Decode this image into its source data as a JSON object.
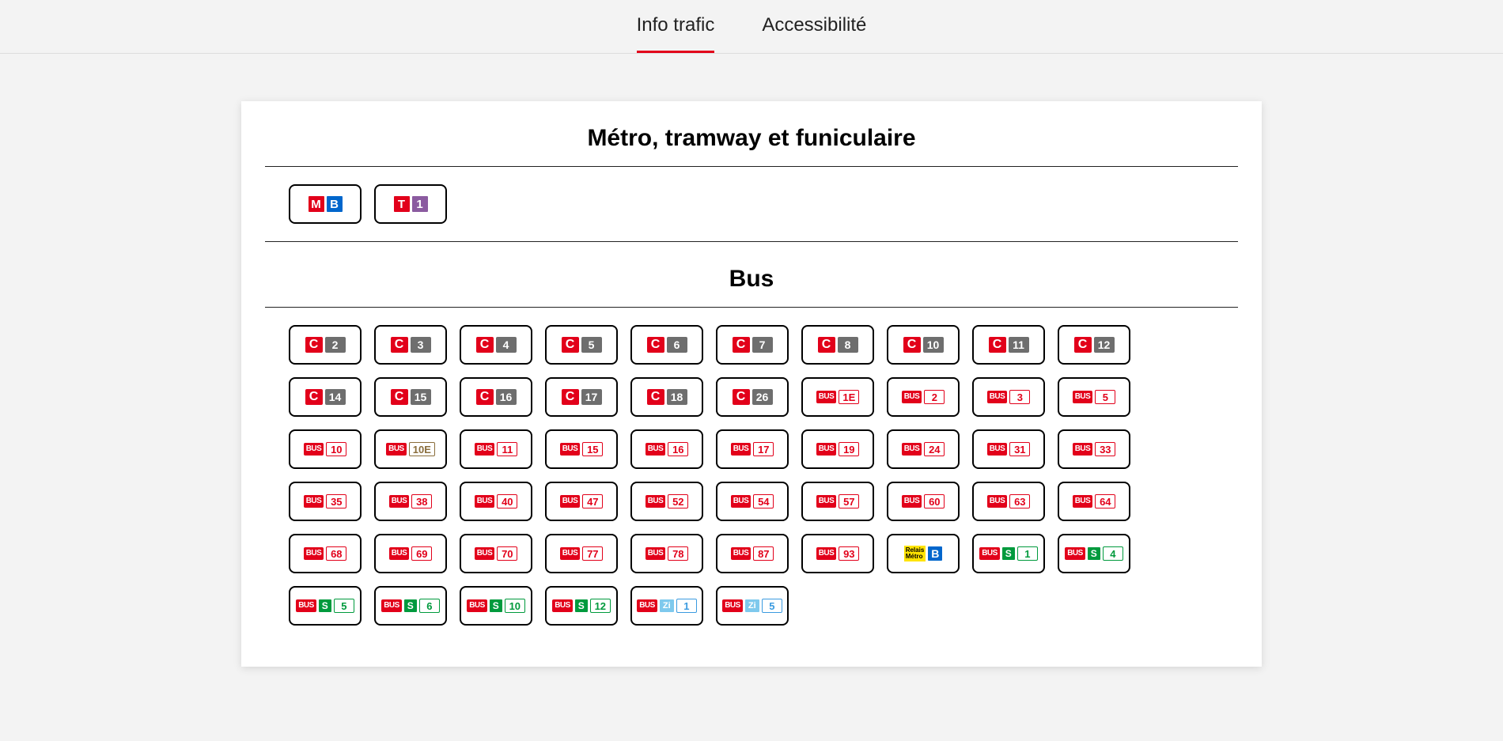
{
  "tabs": {
    "traffic": "Info trafic",
    "accessibility": "Accessibilité"
  },
  "sections": {
    "metro_title": "Métro, tramway et funiculaire",
    "bus_title": "Bus"
  },
  "metro": {
    "m": "M",
    "b": "B",
    "t": "T",
    "t1": "1"
  },
  "labels": {
    "c": "C",
    "bus": "BUS",
    "s": "S",
    "zi": "Zi",
    "relais1": "Relais",
    "relais2": "Métro",
    "relais_b": "B"
  },
  "c_lines": [
    "2",
    "3",
    "4",
    "5",
    "6",
    "7",
    "8",
    "10",
    "11",
    "12",
    "14",
    "15",
    "16",
    "17",
    "18",
    "26"
  ],
  "bus_lines_red": [
    {
      "n": "1E"
    },
    {
      "n": "2"
    },
    {
      "n": "3"
    },
    {
      "n": "5"
    },
    {
      "n": "10"
    },
    {
      "n": "10E",
      "style": "brown"
    },
    {
      "n": "11"
    },
    {
      "n": "15"
    },
    {
      "n": "16"
    },
    {
      "n": "17"
    },
    {
      "n": "19"
    },
    {
      "n": "24"
    },
    {
      "n": "31"
    },
    {
      "n": "33"
    },
    {
      "n": "35"
    },
    {
      "n": "38"
    },
    {
      "n": "40"
    },
    {
      "n": "47"
    },
    {
      "n": "52"
    },
    {
      "n": "54"
    },
    {
      "n": "57"
    },
    {
      "n": "60"
    },
    {
      "n": "63"
    },
    {
      "n": "64"
    },
    {
      "n": "68"
    },
    {
      "n": "69"
    },
    {
      "n": "70"
    },
    {
      "n": "77"
    },
    {
      "n": "78"
    },
    {
      "n": "87"
    },
    {
      "n": "93"
    }
  ],
  "bus_s_lines": [
    "1",
    "4",
    "5",
    "6",
    "10",
    "12"
  ],
  "bus_zi_lines": [
    "1",
    "5"
  ]
}
